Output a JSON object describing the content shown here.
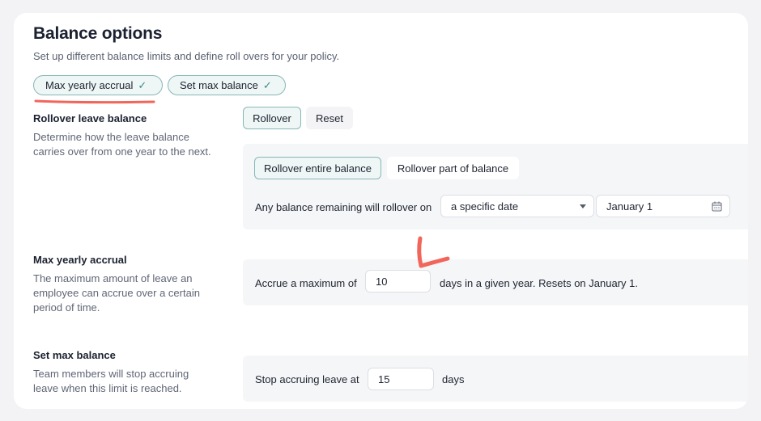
{
  "header": {
    "title": "Balance options",
    "subtitle": "Set up different balance limits and define roll overs for your policy."
  },
  "chips": {
    "max_yearly_accrual": "Max yearly accrual",
    "set_max_balance": "Set max balance",
    "check": "✓"
  },
  "rollover": {
    "title": "Rollover leave balance",
    "description": "Determine how the leave balance carries over from one year to the next.",
    "tabs": {
      "rollover": "Rollover",
      "reset": "Reset"
    },
    "options": {
      "entire": "Rollover entire balance",
      "part": "Rollover part of balance"
    },
    "remaining_label": "Any balance remaining will rollover on",
    "date_type": "a specific date",
    "date_value": "January 1"
  },
  "max_accrual": {
    "title": "Max yearly accrual",
    "description": "The maximum amount of leave an employee can accrue over a certain period of time.",
    "prefix": "Accrue a maximum of",
    "value": "10",
    "suffix": "days in a given year. Resets on January 1."
  },
  "max_balance": {
    "title": "Set max balance",
    "description": "Team members will stop accruing leave when this limit is reached.",
    "prefix": "Stop accruing leave at",
    "value": "15",
    "suffix": "days"
  },
  "colors": {
    "accent_border": "#88b7b5",
    "accent_bg": "#eef6f6",
    "annotation_red": "#f2655a"
  }
}
